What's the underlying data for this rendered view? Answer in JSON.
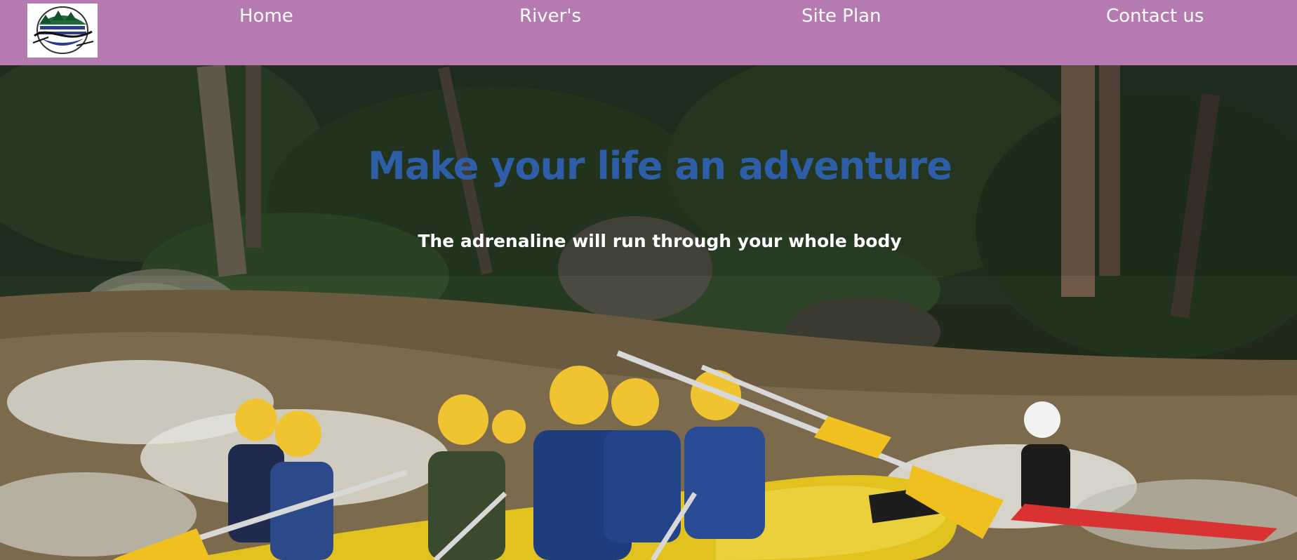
{
  "nav": {
    "logo_alt": "Rafting logo",
    "items": [
      {
        "label": "Home"
      },
      {
        "label": "River's"
      },
      {
        "label": "Site Plan"
      },
      {
        "label": "Contact us"
      }
    ]
  },
  "hero": {
    "title": "Make your life an adventure",
    "subtitle": "The adrenaline will run through your whole body",
    "image_description": "whitewater rafting photo"
  },
  "colors": {
    "navbar": "#b57ab0",
    "title": "#2f5ea8",
    "subtitle": "#ffffff",
    "nav_text": "#ffffff"
  }
}
